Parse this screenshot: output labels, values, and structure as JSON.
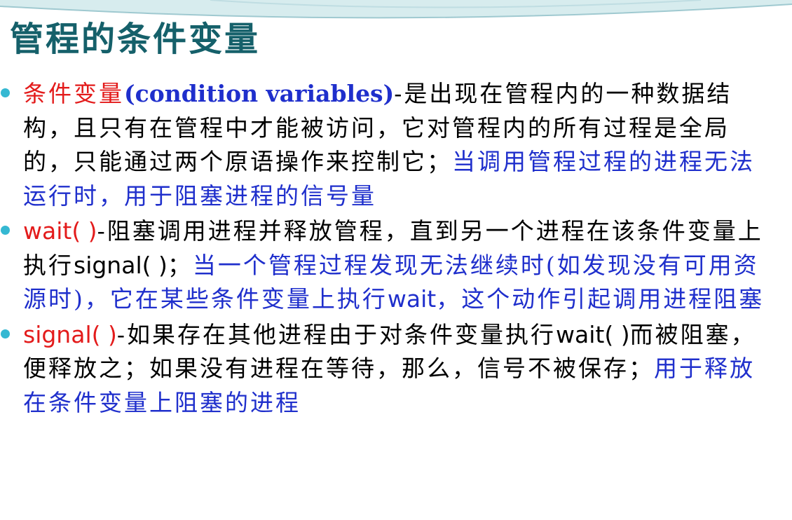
{
  "title": "管程的条件变量",
  "bullets": [
    {
      "term": "条件变量",
      "term_latin": "(condition variables)",
      "text_black": "-是出现在管程内的一种数据结构，且只有在管程中才能被访问，它对管程内的所有过程是全局的，只能通过两个原语操作来控制它；",
      "text_blue": "当调用管程过程的进程无法运行时，用于阻塞进程的信号量"
    },
    {
      "term": "wait( )",
      "text_black_1": "-阻塞调用进程并释放管程，直到另一个进程在该条件变量上执行",
      "text_latin": "signal( )",
      "text_black_2": "；",
      "text_blue_1": "当一个管程过程发现无法继续时(如发现没有可用资源时)，它在某些条件变量上执行",
      "text_blue_latin": "wait",
      "text_blue_2": "，这个动作引起调用进程阻塞"
    },
    {
      "term": "signal( )",
      "text_black_1": "-如果存在其他进程由于对条件变量执行",
      "text_latin": "wait( )",
      "text_black_2": "而被阻塞，便释放之；如果没有进程在等待，那么，信号不被保存；",
      "text_blue": "用于释放在条件变量上阻塞的进程"
    }
  ],
  "colors": {
    "title": "#15606a",
    "term": "#e31b1b",
    "emphasis": "#1f2fcc",
    "bullet_dot": "#35b8d2"
  }
}
